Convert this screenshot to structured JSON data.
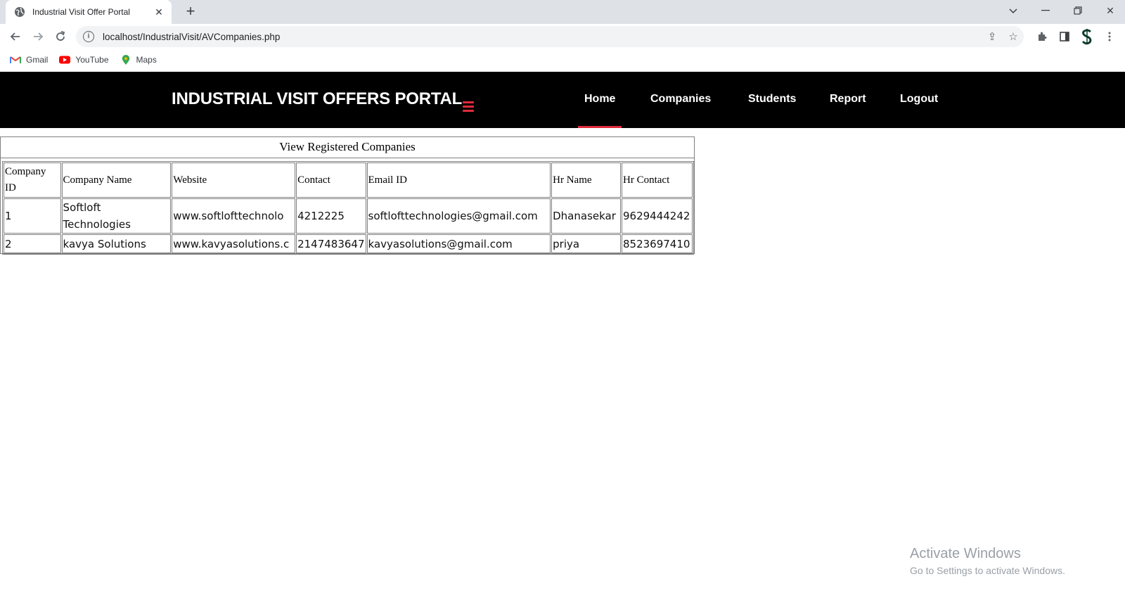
{
  "browser": {
    "tab_title": "Industrial Visit Offer Portal",
    "url": "localhost/IndustrialVisit/AVCompanies.php",
    "bookmarks": [
      "Gmail",
      "YouTube",
      "Maps"
    ]
  },
  "site": {
    "brand": "INDUSTRIAL VISIT OFFERS PORTAL",
    "nav": [
      "Home",
      "Companies",
      "Students",
      "Report",
      "Logout"
    ],
    "active_nav": "Home",
    "accent_color": "#e02a3a"
  },
  "companies": {
    "caption": "View Registered Companies",
    "headers": [
      "Company ID",
      "Company Name",
      "Website",
      "Contact",
      "Email ID",
      "Hr Name",
      "Hr Contact"
    ],
    "rows": [
      [
        "1",
        "Softloft Technologies",
        "www.softlofttechnolo",
        "4212225",
        "softlofttechnologies@gmail.com",
        "Dhanasekar",
        "9629444242"
      ],
      [
        "2",
        "kavya Solutions",
        "www.kavyasolutions.c",
        "2147483647",
        "kavyasolutions@gmail.com",
        "priya",
        "8523697410"
      ]
    ]
  },
  "watermark": {
    "line1": "Activate Windows",
    "line2": "Go to Settings to activate Windows."
  }
}
